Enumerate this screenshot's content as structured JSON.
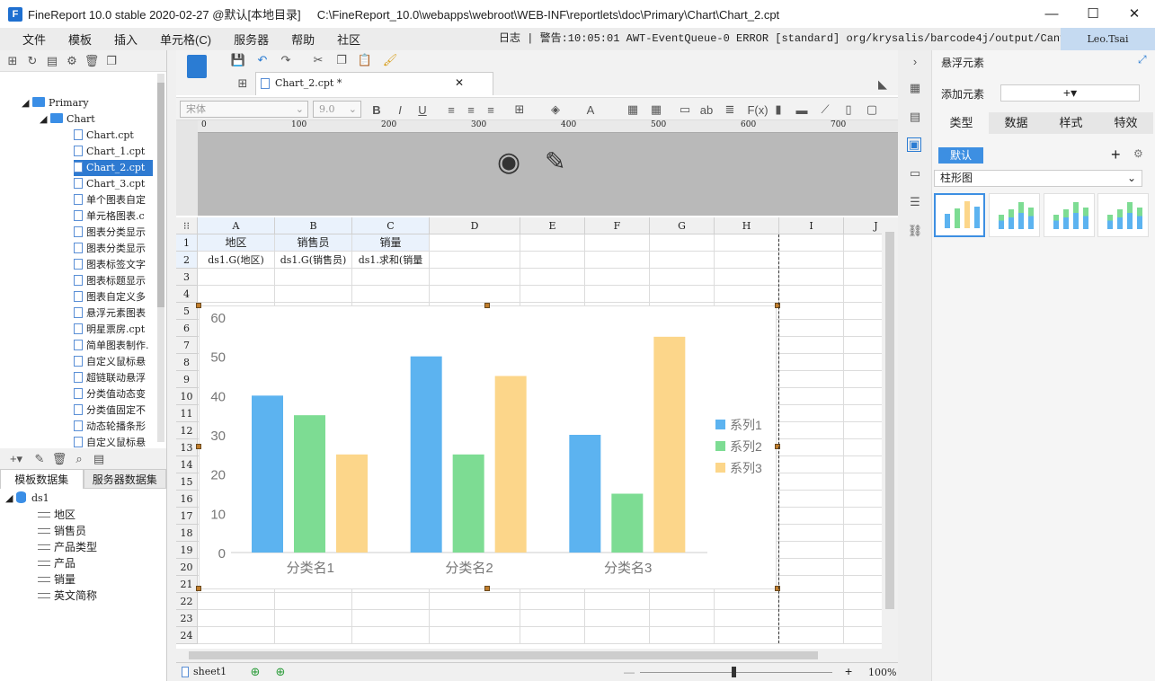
{
  "titlebar": {
    "text": "FineReport 10.0 stable 2020-02-27 @默认[本地目录]     C:\\FineReport_10.0\\webapps\\webroot\\WEB-INF\\reportlets\\doc\\Primary\\Chart\\Chart_2.cpt"
  },
  "menu": [
    "文件",
    "模板",
    "插入",
    "单元格(C)",
    "服务器",
    "帮助",
    "社区"
  ],
  "log": "日志 | 警告:10:05:01 AWT-EventQueue-0 ERROR [standard] org/krysalis/barcode4j/output/CanvasProvider",
  "user": "Leo.Tsai",
  "tree": {
    "folders": [
      "Primary",
      "Chart"
    ],
    "files": [
      "Chart.cpt",
      "Chart_1.cpt",
      "Chart_2.cpt",
      "Chart_3.cpt",
      "单个图表自定",
      "单元格图表.c",
      "图表分类显示",
      "图表分类显示",
      "图表标签文字",
      "图表标题显示",
      "图表自定义多",
      "悬浮元素图表",
      "明星票房.cpt",
      "简单图表制作.",
      "自定义鼠标悬",
      "超链联动悬浮",
      "分类值动态变",
      "分类值固定不",
      "动态轮播条形",
      "自定义鼠标悬"
    ]
  },
  "dstabs": [
    "模板数据集",
    "服务器数据集"
  ],
  "dataset": {
    "name": "ds1",
    "fields": [
      "地区",
      "销售员",
      "产品类型",
      "产品",
      "销量",
      "英文简称"
    ]
  },
  "doctab": "Chart_2.cpt *",
  "font": {
    "name": "宋体",
    "size": "9.0"
  },
  "ruler": [
    "0",
    "100",
    "200",
    "300",
    "400",
    "500",
    "600",
    "700"
  ],
  "columns": [
    "A",
    "B",
    "C",
    "D",
    "E",
    "F",
    "G",
    "H",
    "I",
    "J"
  ],
  "cells": {
    "a1": "地区",
    "b1": "销售员",
    "c1": "销量",
    "a2": "ds1.G(地区)",
    "b2": "ds1.G(销售员)",
    "c2": "ds1.求和(销量"
  },
  "sheet": "sheet1",
  "zoom": "100%",
  "rightpanel": {
    "title": "悬浮元素",
    "add_label": "添加元素",
    "tabs": [
      "类型",
      "数据",
      "样式",
      "特效"
    ],
    "default_badge": "默认",
    "chart_type": "柱形图"
  },
  "chart_data": {
    "type": "bar",
    "categories": [
      "分类名1",
      "分类名2",
      "分类名3"
    ],
    "series": [
      {
        "name": "系列1",
        "values": [
          40,
          50,
          30
        ],
        "color": "#5cb3f0"
      },
      {
        "name": "系列2",
        "values": [
          35,
          25,
          15
        ],
        "color": "#7ddc93"
      },
      {
        "name": "系列3",
        "values": [
          25,
          45,
          55
        ],
        "color": "#fcd68a"
      }
    ],
    "ylim": [
      0,
      60
    ],
    "yticks": [
      "0",
      "10",
      "20",
      "30",
      "40",
      "50",
      "60"
    ],
    "legend": "right"
  }
}
